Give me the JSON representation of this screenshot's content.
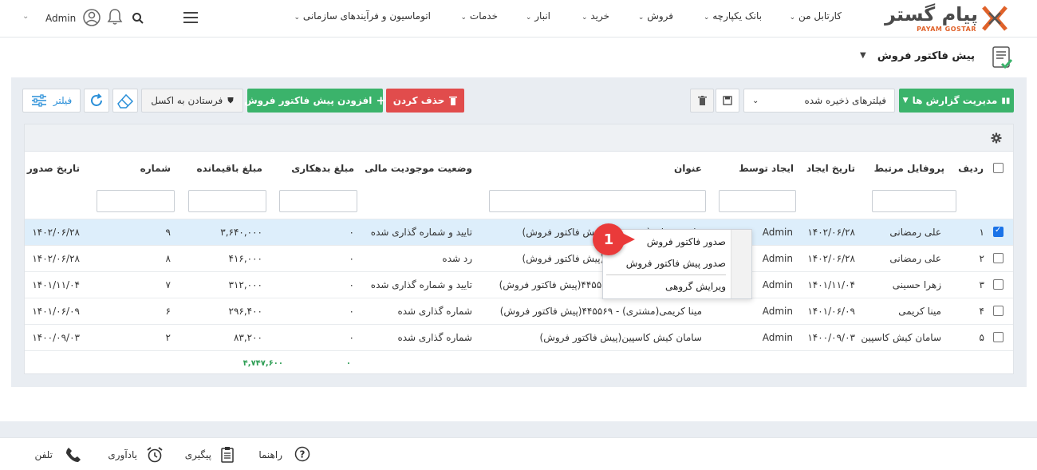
{
  "brand": {
    "name": "پیام گستر",
    "sub": "PAYAM GOSTAR"
  },
  "nav": {
    "items": [
      "کارتابل من",
      "بانک یکپارچه",
      "فروش",
      "خرید",
      "انبار",
      "خدمات",
      "اتوماسیون و فرآیندهای سازمانی"
    ],
    "user": "Admin"
  },
  "page": {
    "title": "پیش فاکتور فروش"
  },
  "toolbar": {
    "reports_label": "مدیریت گزارش ها",
    "saved_filters_placeholder": "فیلترهای ذخیره شده",
    "delete_label": "حذف کردن",
    "add_label": "افزودن پیش فاکتور فروش",
    "excel_label": "فرستادن به اکسل",
    "filter_label": "فیلتر"
  },
  "table": {
    "headers": {
      "row": "ردیف",
      "profile": "پروفایل مرتبط",
      "created": "تاریخ ایجاد",
      "creator": "ایجاد توسط",
      "title": "عنوان",
      "status": "وضعیت موجودیت مالی",
      "debt": "مبلغ بدهکاری",
      "remaining": "مبلغ باقیمانده",
      "number": "شماره",
      "issued": "تاریخ صدور"
    },
    "rows": [
      {
        "idx": "۱",
        "profile": "علی رمضانی",
        "created": "۱۴۰۲/۰۶/۲۸",
        "creator": "Admin",
        "title": "علی رمضانی(مشتری) - (پیش فاکتور فروش)",
        "status": "تایید و شماره گذاری شده",
        "debt": "۰",
        "remaining": "۳,۶۴۰,۰۰۰",
        "number": "۹",
        "issued": "۱۴۰۲/۰۶/۲۸"
      },
      {
        "idx": "۲",
        "profile": "علی رمضانی",
        "created": "۱۴۰۲/۰۶/۲۸",
        "creator": "Admin",
        "title": "علی رمضانی(مشتری) - (پیش فاکتور فروش)",
        "status": "رد شده",
        "debt": "۰",
        "remaining": "۴۱۶,۰۰۰",
        "number": "۸",
        "issued": "۱۴۰۲/۰۶/۲۸"
      },
      {
        "idx": "۳",
        "profile": "زهرا حسینی",
        "created": "۱۴۰۱/۱۱/۰۴",
        "creator": "Admin",
        "title": "زهرا حسینی(مشتری) - ۴۴۵۵۱(پیش فاکتور فروش)",
        "status": "تایید و شماره گذاری شده",
        "debt": "۰",
        "remaining": "۳۱۲,۰۰۰",
        "number": "۷",
        "issued": "۱۴۰۱/۱۱/۰۴"
      },
      {
        "idx": "۴",
        "profile": "مینا کریمی",
        "created": "۱۴۰۱/۰۶/۰۹",
        "creator": "Admin",
        "title": "مینا کریمی(مشتری) - ۴۴۵۵۶۹(پیش فاکتور فروش)",
        "status": "شماره گذاری شده",
        "debt": "۰",
        "remaining": "۲۹۶,۴۰۰",
        "number": "۶",
        "issued": "۱۴۰۱/۰۶/۰۹"
      },
      {
        "idx": "۵",
        "profile": "سامان کیش کاسپین",
        "created": "۱۴۰۰/۰۹/۰۳",
        "creator": "Admin",
        "title": "سامان کیش کاسپین(پیش فاکتور فروش)",
        "status": "شماره گذاری شده",
        "debt": "۰",
        "remaining": "۸۳,۲۰۰",
        "number": "۲",
        "issued": "۱۴۰۰/۰۹/۰۳"
      }
    ],
    "totals": {
      "remaining": "۴,۷۴۷,۶۰۰",
      "debt": "۰"
    }
  },
  "context_menu": {
    "items": [
      "صدور فاکتور فروش",
      "صدور پیش فاکتور فروش",
      "ویرایش گروهی"
    ],
    "badge": "1"
  },
  "footer": {
    "items": [
      "راهنما",
      "پیگیری",
      "یادآوری",
      "تلفن"
    ]
  },
  "colors": {
    "green": "#3bb36b",
    "red": "#e14c4c",
    "accent": "#1a73e8",
    "brand_orange": "#e0622a"
  }
}
